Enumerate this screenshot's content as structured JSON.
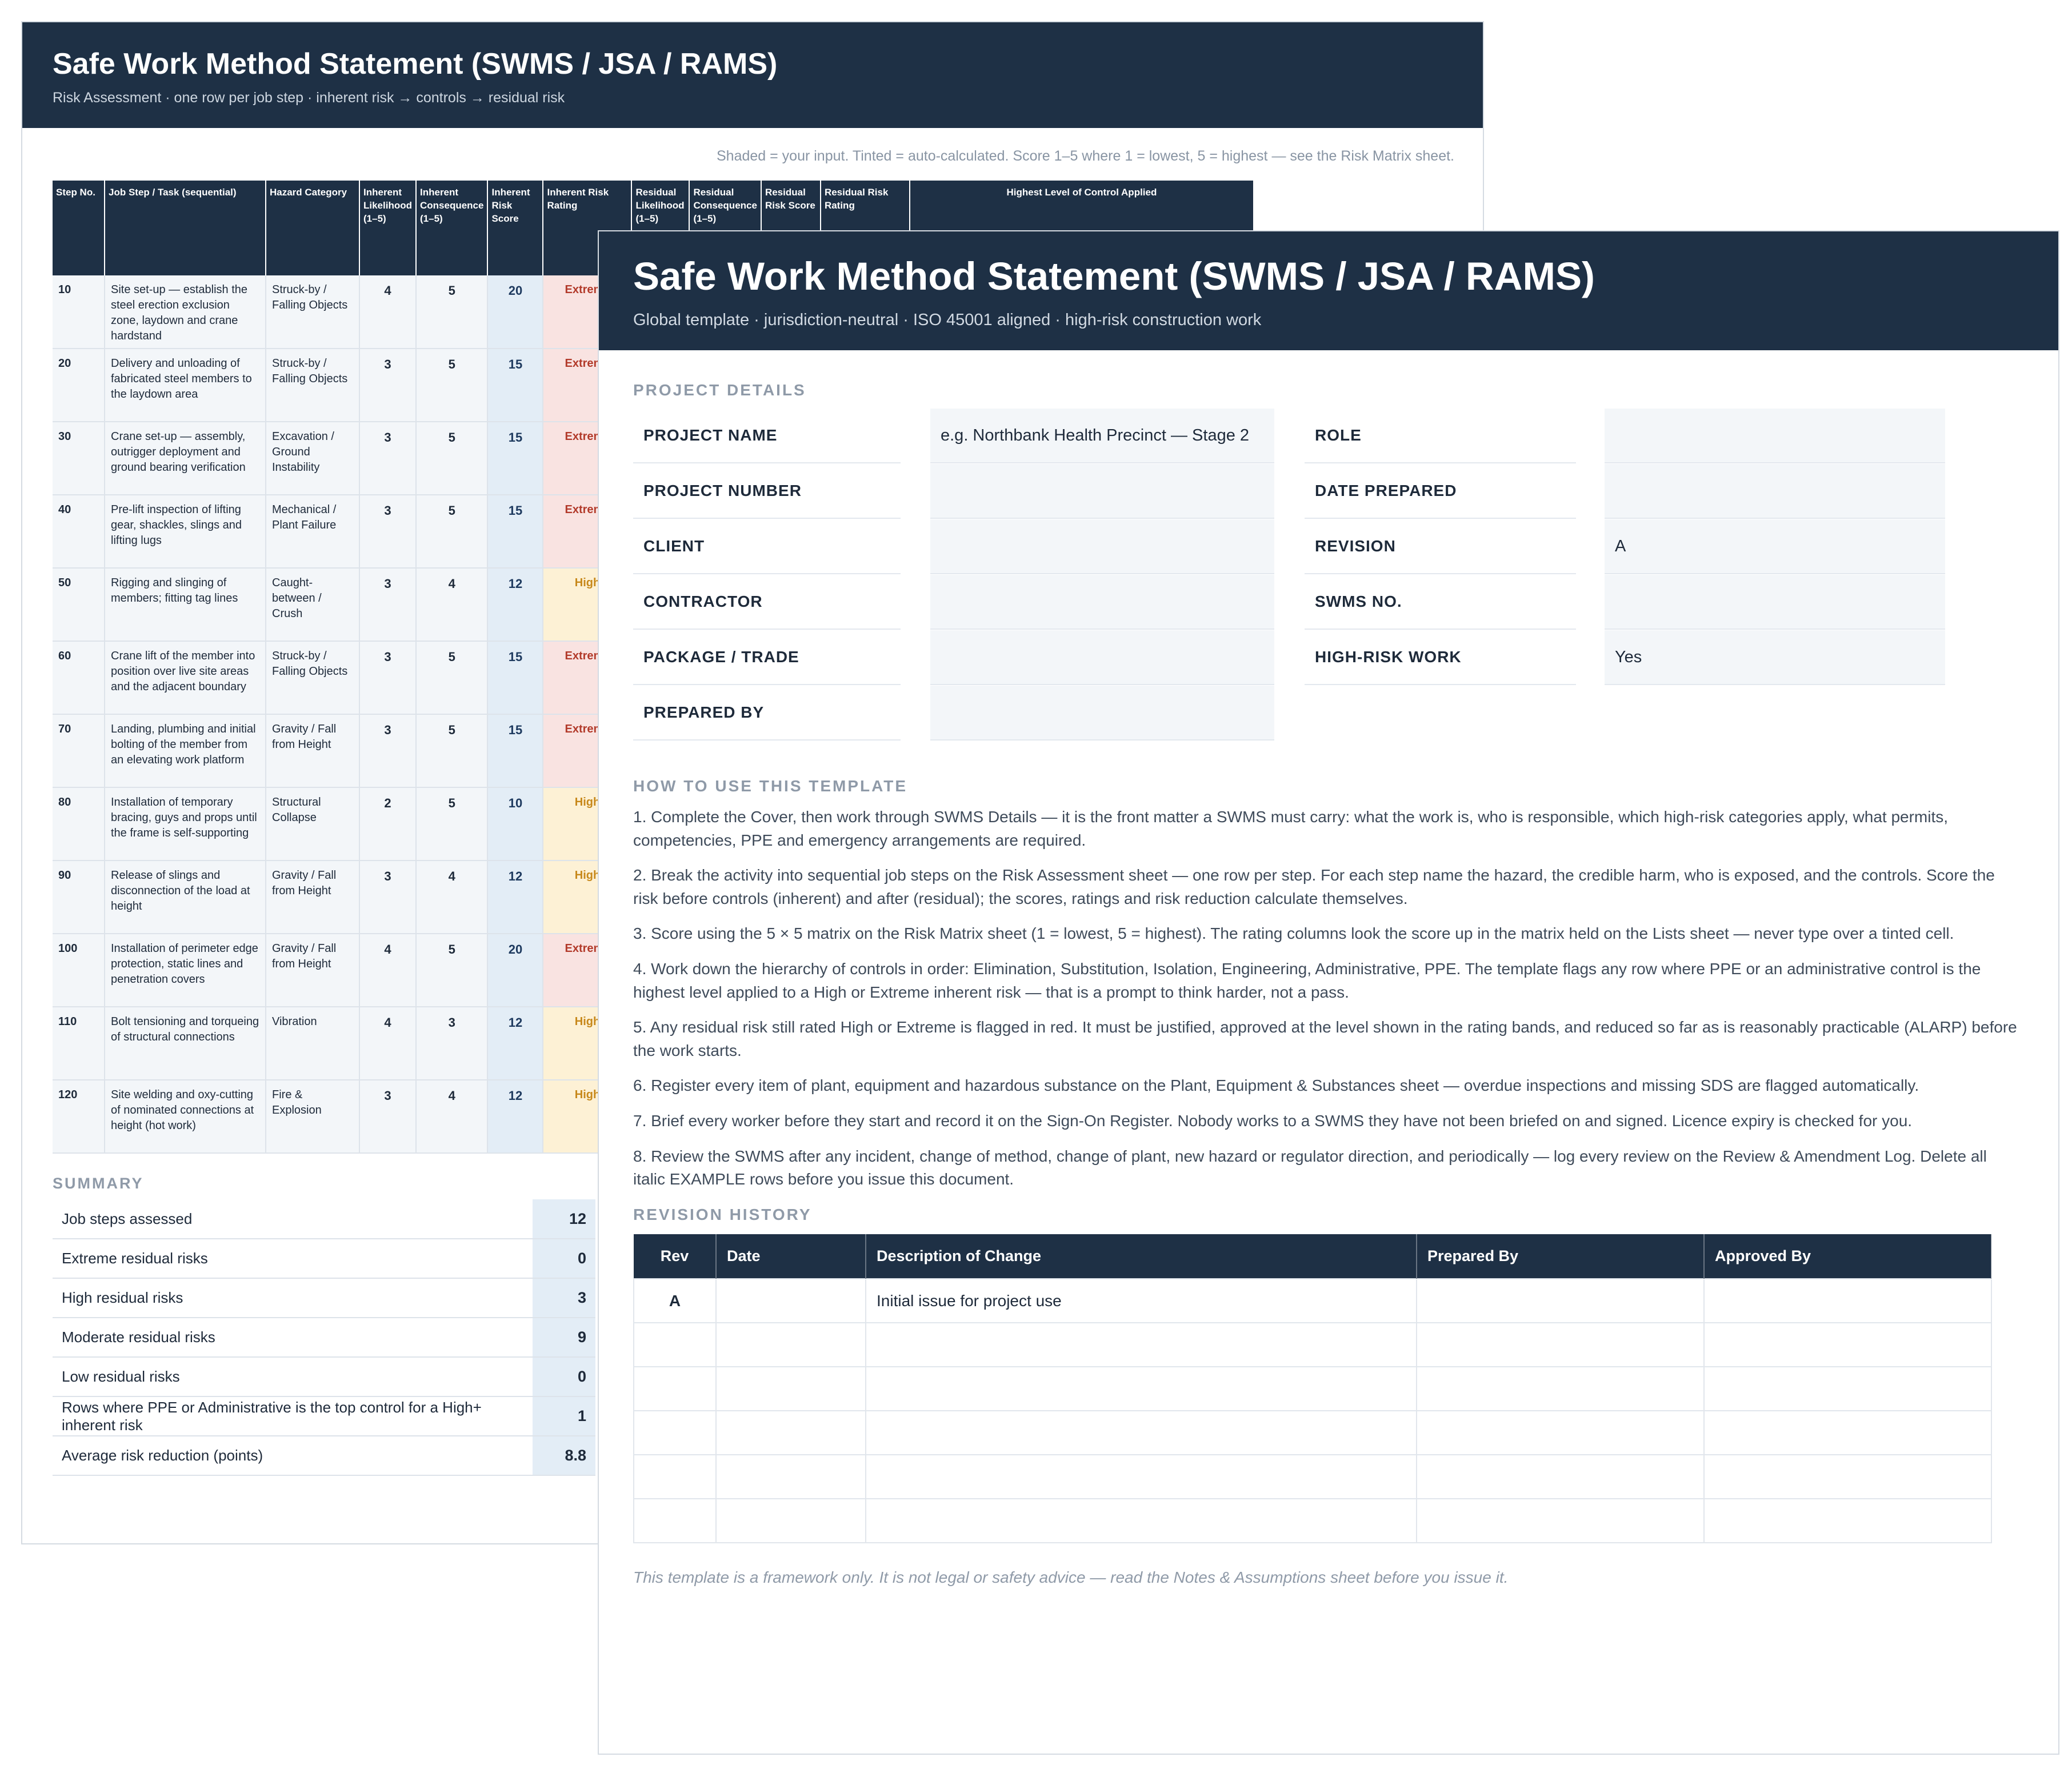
{
  "back_sheet": {
    "title": "Safe Work Method Statement (SWMS / JSA / RAMS)",
    "subtitle": "Risk Assessment  ·  one row per job step  ·  inherent risk → controls → residual risk",
    "legend": "Shaded = your input.  Tinted = auto-calculated.  Score 1–5 where 1 = lowest, 5 = highest — see the Risk Matrix sheet.",
    "columns": [
      "Step No.",
      "Job Step / Task (sequential)",
      "Hazard Category",
      "Inherent Likelihood (1–5)",
      "Inherent Consequence (1–5)",
      "Inherent Risk Score",
      "Inherent Risk Rating",
      "Residual Likelihood (1–5)",
      "Residual Consequence (1–5)",
      "Residual Risk Score",
      "Residual Risk Rating",
      "Highest Level of Control Applied"
    ],
    "rows": [
      {
        "step": "10",
        "task": "Site set-up — establish the steel erection exclusion zone, laydown and crane hardstand",
        "hazard": "Struck-by / Falling Objects",
        "l": "4",
        "c": "5",
        "score": "20",
        "rating": "Extreme"
      },
      {
        "step": "20",
        "task": "Delivery and unloading of fabricated steel members to the laydown area",
        "hazard": "Struck-by / Falling Objects",
        "l": "3",
        "c": "5",
        "score": "15",
        "rating": "Extreme"
      },
      {
        "step": "30",
        "task": "Crane set-up — assembly, outrigger deployment and ground bearing verification",
        "hazard": "Excavation / Ground Instability",
        "l": "3",
        "c": "5",
        "score": "15",
        "rating": "Extreme"
      },
      {
        "step": "40",
        "task": "Pre-lift inspection of lifting gear, shackles, slings and lifting lugs",
        "hazard": "Mechanical / Plant Failure",
        "l": "3",
        "c": "5",
        "score": "15",
        "rating": "Extreme"
      },
      {
        "step": "50",
        "task": "Rigging and slinging of members; fitting tag lines",
        "hazard": "Caught-between / Crush",
        "l": "3",
        "c": "4",
        "score": "12",
        "rating": "High"
      },
      {
        "step": "60",
        "task": "Crane lift of the member into position over live site areas and the adjacent boundary",
        "hazard": "Struck-by / Falling Objects",
        "l": "3",
        "c": "5",
        "score": "15",
        "rating": "Extreme"
      },
      {
        "step": "70",
        "task": "Landing, plumbing and initial bolting of the member from an elevating work platform",
        "hazard": "Gravity / Fall from Height",
        "l": "3",
        "c": "5",
        "score": "15",
        "rating": "Extreme"
      },
      {
        "step": "80",
        "task": "Installation of temporary bracing, guys and props until the frame is self-supporting",
        "hazard": "Structural Collapse",
        "l": "2",
        "c": "5",
        "score": "10",
        "rating": "High"
      },
      {
        "step": "90",
        "task": "Release of slings and disconnection of the load at height",
        "hazard": "Gravity / Fall from Height",
        "l": "3",
        "c": "4",
        "score": "12",
        "rating": "High"
      },
      {
        "step": "100",
        "task": "Installation of perimeter edge protection, static lines and penetration covers",
        "hazard": "Gravity / Fall from Height",
        "l": "4",
        "c": "5",
        "score": "20",
        "rating": "Extreme"
      },
      {
        "step": "110",
        "task": "Bolt tensioning and torqueing of structural connections",
        "hazard": "Vibration",
        "l": "4",
        "c": "3",
        "score": "12",
        "rating": "High"
      },
      {
        "step": "120",
        "task": "Site welding and oxy-cutting of nominated connections at height (hot work)",
        "hazard": "Fire & Explosion",
        "l": "3",
        "c": "4",
        "score": "12",
        "rating": "High"
      }
    ],
    "summary_label": "SUMMARY",
    "summary": [
      {
        "label": "Job steps assessed",
        "value": "12"
      },
      {
        "label": "Extreme residual risks",
        "value": "0"
      },
      {
        "label": "High residual risks",
        "value": "3"
      },
      {
        "label": "Moderate residual risks",
        "value": "9"
      },
      {
        "label": "Low residual risks",
        "value": "0"
      },
      {
        "label": "Rows where PPE or Administrative is the top control for a High+ inherent risk",
        "value": "1"
      },
      {
        "label": "Average risk reduction (points)",
        "value": "8.8"
      }
    ]
  },
  "front_sheet": {
    "title": "Safe Work Method Statement (SWMS / JSA / RAMS)",
    "subtitle": "Global template  ·  jurisdiction-neutral  ·  ISO 45001 aligned  ·  high-risk construction work",
    "project_details_label": "PROJECT DETAILS",
    "left_fields": [
      {
        "label": "PROJECT NAME",
        "value": "e.g. Northbank Health Precinct — Stage 2"
      },
      {
        "label": "PROJECT NUMBER",
        "value": ""
      },
      {
        "label": "CLIENT",
        "value": ""
      },
      {
        "label": "CONTRACTOR",
        "value": ""
      },
      {
        "label": "PACKAGE / TRADE",
        "value": ""
      },
      {
        "label": "PREPARED BY",
        "value": ""
      }
    ],
    "right_fields": [
      {
        "label": "ROLE",
        "value": ""
      },
      {
        "label": "DATE PREPARED",
        "value": ""
      },
      {
        "label": "REVISION",
        "value": "A"
      },
      {
        "label": "SWMS NO.",
        "value": ""
      },
      {
        "label": "HIGH-RISK WORK",
        "value": "Yes"
      }
    ],
    "howto_label": "HOW TO USE THIS TEMPLATE",
    "howto": [
      "1. Complete the Cover, then work through SWMS Details — it is the front matter a SWMS must carry: what the work is, who is responsible, which high-risk categories apply, what permits, competencies, PPE and emergency arrangements are required.",
      "2. Break the activity into sequential job steps on the Risk Assessment sheet — one row per step. For each step name the hazard, the credible harm, who is exposed, and the controls. Score the risk before controls (inherent) and after (residual); the scores, ratings and risk reduction calculate themselves.",
      "3. Score using the 5 × 5 matrix on the Risk Matrix sheet (1 = lowest, 5 = highest). The rating columns look the score up in the matrix held on the Lists sheet — never type over a tinted cell.",
      "4. Work down the hierarchy of controls in order: Elimination, Substitution, Isolation, Engineering, Administrative, PPE. The template flags any row where PPE or an administrative control is the highest level applied to a High or Extreme inherent risk — that is a prompt to think harder, not a pass.",
      "5. Any residual risk still rated High or Extreme is flagged in red. It must be justified, approved at the level shown in the rating bands, and reduced so far as is reasonably practicable (ALARP) before the work starts.",
      "6. Register every item of plant, equipment and hazardous substance on the Plant, Equipment & Substances sheet — overdue inspections and missing SDS are flagged automatically.",
      "7. Brief every worker before they start and record it on the Sign-On Register. Nobody works to a SWMS they have not been briefed on and signed. Licence expiry is checked for you.",
      "8. Review the SWMS after any incident, change of method, change of plant, new hazard or regulator direction, and periodically — log every review on the Review & Amendment Log. Delete all italic EXAMPLE rows before you issue this document."
    ],
    "revision_label": "REVISION HISTORY",
    "revision_columns": [
      "Rev",
      "Date",
      "Description of Change",
      "Prepared By",
      "Approved By"
    ],
    "revision_rows": [
      [
        "A",
        "",
        "Initial issue for project use",
        "",
        ""
      ],
      [
        "",
        "",
        "",
        "",
        ""
      ],
      [
        "",
        "",
        "",
        "",
        ""
      ],
      [
        "",
        "",
        "",
        "",
        ""
      ],
      [
        "",
        "",
        "",
        "",
        ""
      ],
      [
        "",
        "",
        "",
        "",
        ""
      ]
    ],
    "footnote": "This template is a framework only. It is not legal or safety advice — read the Notes & Assumptions sheet before you issue it."
  }
}
